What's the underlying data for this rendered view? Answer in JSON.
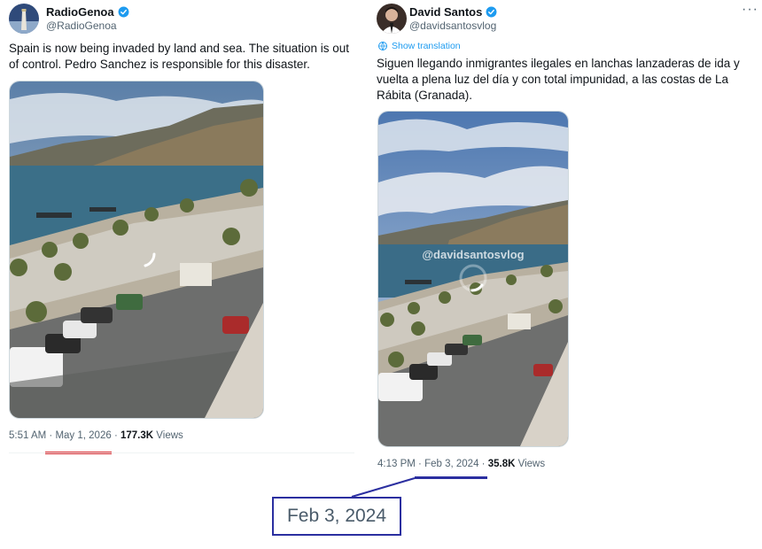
{
  "left_tweet": {
    "author_name": "RadioGenoa",
    "handle": "@RadioGenoa",
    "text": "Spain is now being invaded by land and sea. The situation is out of control. Pedro Sanchez is responsible for this disaster.",
    "time": "5:51 AM",
    "date": "May 1, 2026",
    "separator": "·",
    "views_count": "177.3K",
    "views_label": "Views"
  },
  "right_tweet": {
    "author_name": "David Santos",
    "handle": "@davidsantosvlog",
    "translate_label": "Show translation",
    "text": "Siguen llegando inmigrantes ilegales en lanchas lanzaderas de ida y vuelta a plena luz del día y con total impunidad, a las costas de La Rábita (Granada).",
    "watermark": "@davidsantosvlog",
    "time": "4:13 PM",
    "date": "Feb 3, 2024",
    "separator": "·",
    "views_count": "35.8K",
    "views_label": "Views",
    "more_icon": "more-icon"
  },
  "annotation": {
    "zoomed_date": "Feb 3, 2024",
    "underline_color": "#d9262b",
    "box_color": "#2b2fa0"
  },
  "icons": {
    "verified": "verified-badge-icon",
    "translate": "globe-icon",
    "loading": "loading-spinner-icon"
  }
}
